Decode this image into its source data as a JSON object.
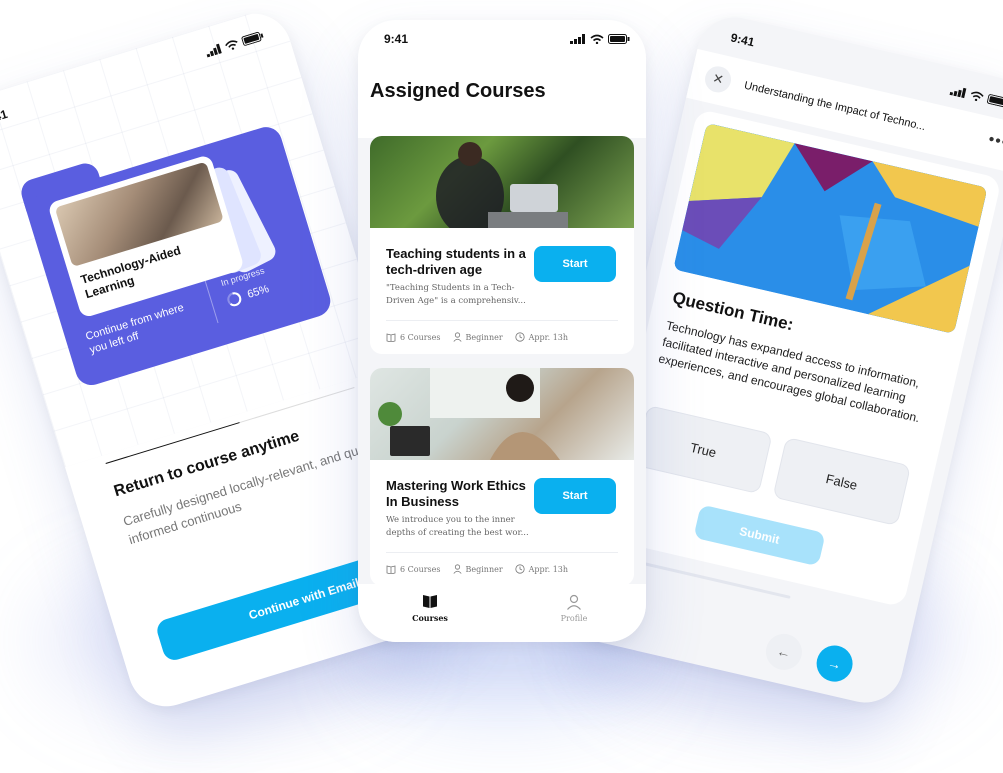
{
  "status_time": "9:41",
  "left": {
    "card_title": "Technology-Aided Learning",
    "continue_text": "Continue from where you left off",
    "progress_label": "In progress",
    "progress_value": "65%",
    "progress_fraction": 0.65,
    "heading": "Return to course anytime",
    "description": "Carefully designed locally-relevant, and quality research-informed continuous",
    "cta_label": "Continue with Email"
  },
  "center": {
    "title": "Assigned Courses",
    "courses": [
      {
        "title": "Teaching students in a tech-driven age",
        "description": "\"Teaching Students in a Tech-Driven Age\" is a comprehensiv...",
        "start_label": "Start",
        "courses_count": "6 Courses",
        "level": "Beginner",
        "duration": "Appr. 13h"
      },
      {
        "title": "Mastering Work Ethics In Business",
        "description": "We introduce you to the inner depths of creating the best wor...",
        "start_label": "Start",
        "courses_count": "6 Courses",
        "level": "Beginner",
        "duration": "Appr. 13h"
      }
    ],
    "nav": {
      "courses": "Courses",
      "profile": "Profile"
    }
  },
  "right": {
    "title": "Understanding the Impact of Techno...",
    "question_heading": "Question Time:",
    "question_text": "Technology has expanded access to information, facilitated interactive and personalized learning experiences, and encourages global collaboration.",
    "option_true": "True",
    "option_false": "False",
    "submit_label": "Submit",
    "progress_fraction": 0.22
  },
  "colors": {
    "accent": "#0ab0ef",
    "purple": "#5a5ee0",
    "submit_disabled": "#a8e2fb"
  }
}
